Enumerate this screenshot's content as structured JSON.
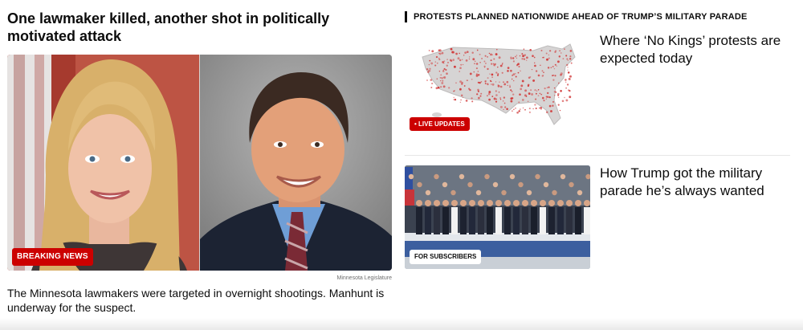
{
  "lead": {
    "headline": "One lawmaker killed, another shot in politically motivated attack",
    "badge": "BREAKING NEWS",
    "credit": "Minnesota Legislature",
    "summary": "The Minnesota lawmakers were targeted in overnight shootings. Manhunt is underway for the suspect."
  },
  "section": {
    "title": "PROTESTS PLANNED NATIONWIDE AHEAD OF TRUMP’S MILITARY PARADE"
  },
  "stories": [
    {
      "headline": "Where ‘No Kings’ protests are expected today",
      "badge": "LIVE UPDATES",
      "thumb": "protest-map"
    },
    {
      "headline": "How Trump got the military parade he’s always wanted",
      "badge": "FOR SUBSCRIBERS",
      "thumb": "parade-photo"
    }
  ],
  "colors": {
    "accent": "#cc0000",
    "text": "#0c0c0c"
  }
}
